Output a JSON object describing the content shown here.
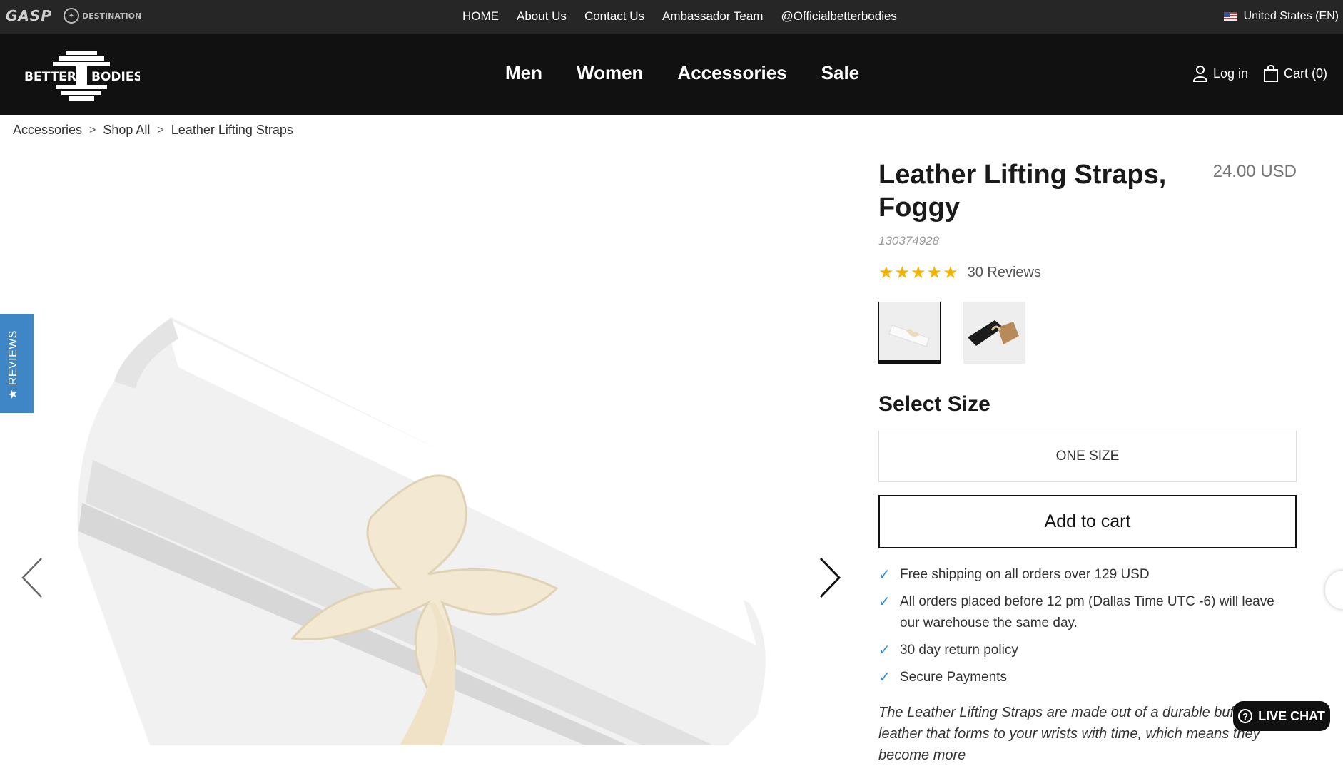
{
  "topbar": {
    "brands": [
      "GASP",
      "DESTINATION"
    ],
    "links": [
      "HOME",
      "About Us",
      "Contact Us",
      "Ambassador Team",
      "@Officialbetterbodies"
    ],
    "region": "United States (EN)"
  },
  "header": {
    "logo_text": [
      "BETTER",
      "BODIES"
    ],
    "categories": [
      "Men",
      "Women",
      "Accessories",
      "Sale"
    ],
    "login": "Log in",
    "cart": "Cart (0)"
  },
  "breadcrumb": [
    "Accessories",
    "Shop All",
    "Leather Lifting Straps"
  ],
  "side_tab": "★ REVIEWS",
  "product": {
    "title": "Leather Lifting Straps, Foggy",
    "price": "24.00 USD",
    "sku": "130374928",
    "rating_stars": "★★★★★",
    "rating_value": 5,
    "reviews": "30 Reviews",
    "size_heading": "Select Size",
    "size_option": "ONE SIZE",
    "add_to_cart": "Add to cart",
    "benefits": [
      "Free shipping on all orders over 129 USD",
      "All orders placed before 12 pm (Dallas Time UTC -6) will leave our warehouse the same day.",
      "30 day return policy",
      "Secure Payments"
    ],
    "description": "The Leather Lifting Straps are made out of a durable buffalo leather that forms to your wrists with time, which means they become more"
  },
  "live_chat": "LIVE CHAT",
  "colors": {
    "topbar_bg": "#262626",
    "nav_bg": "#111111",
    "review_tab": "#3f86c7",
    "star": "#f5b400",
    "check": "#2a8fd6"
  }
}
